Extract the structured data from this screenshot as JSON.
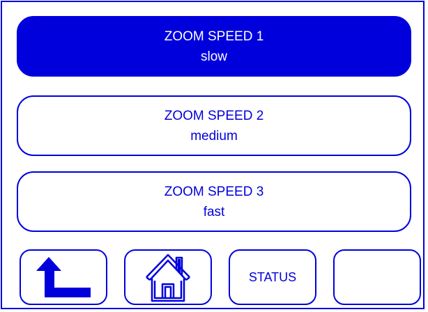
{
  "colors": {
    "accent": "#0000dd",
    "background": "#ffffff",
    "active_text": "#ffffff"
  },
  "speed_options": [
    {
      "title": "ZOOM SPEED 1",
      "subtitle": "slow",
      "selected": true
    },
    {
      "title": "ZOOM SPEED 2",
      "subtitle": "medium",
      "selected": false
    },
    {
      "title": "ZOOM SPEED 3",
      "subtitle": "fast",
      "selected": false
    }
  ],
  "bottom_bar": {
    "back_icon": "back-arrow-icon",
    "home_icon": "home-icon",
    "status_label": "STATUS",
    "empty_label": ""
  }
}
